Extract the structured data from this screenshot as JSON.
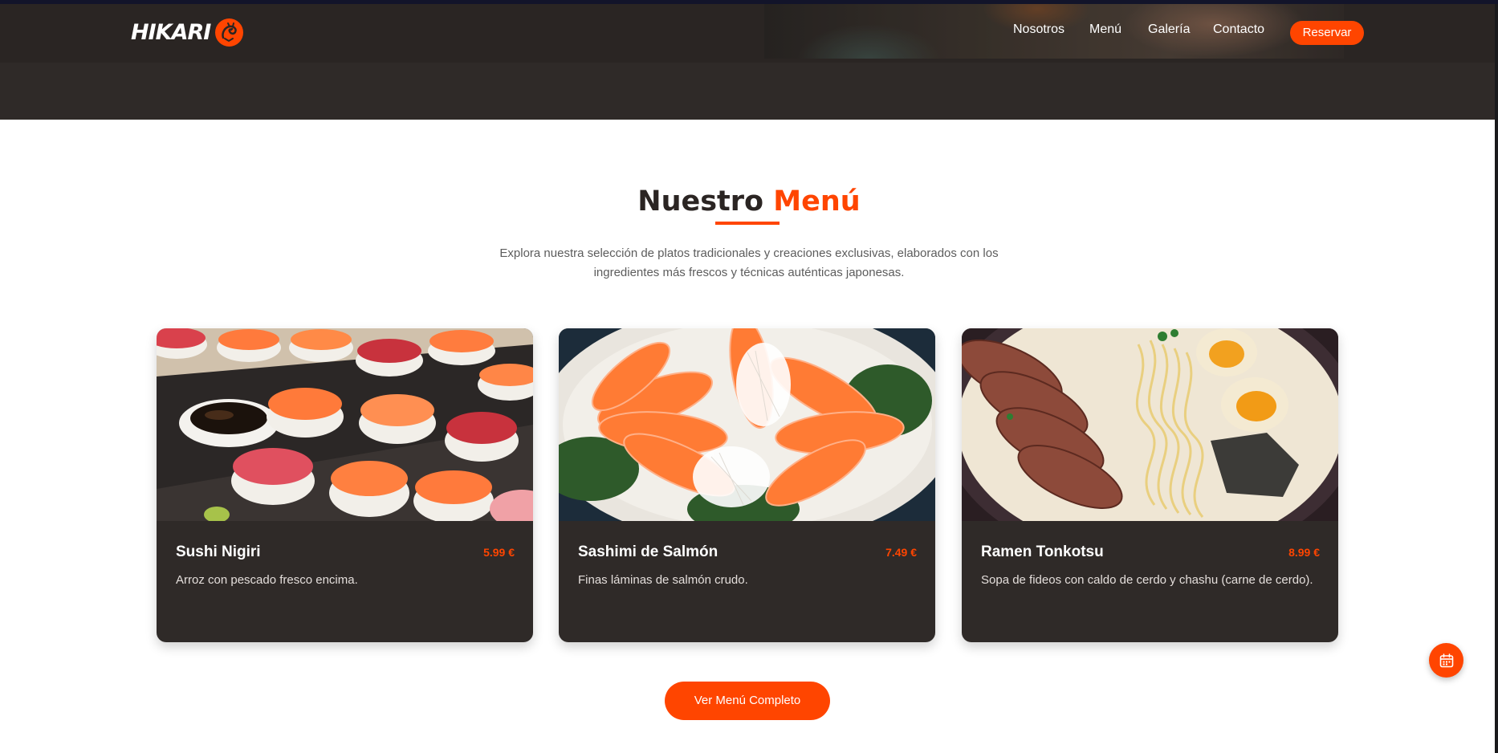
{
  "brand": {
    "name": "HIKARI",
    "logo_icon": "dragon-icon"
  },
  "nav": {
    "items": [
      {
        "label": "Nosotros"
      },
      {
        "label": "Menú"
      },
      {
        "label": "Galería"
      },
      {
        "label": "Contacto"
      }
    ],
    "reserve_label": "Reservar"
  },
  "menu_section": {
    "title_main": "Nuestro",
    "title_accent": "Menú",
    "intro_line1": "Explora nuestra selección de platos tradicionales y creaciones exclusivas, elaborados con los",
    "intro_line2": "ingredientes más frescos y técnicas auténticas japonesas.",
    "dishes": [
      {
        "name": "Sushi Nigiri",
        "price": "5.99 €",
        "description": "Arroz con pescado fresco encima."
      },
      {
        "name": "Sashimi de Salmón",
        "price": "7.49 €",
        "description": "Finas láminas de salmón crudo."
      },
      {
        "name": "Ramen Tonkotsu",
        "price": "8.99 €",
        "description": "Sopa de fideos con caldo de cerdo y chashu (carne de cerdo)."
      }
    ],
    "cta_label": "Ver Menú Completo"
  },
  "floating_button": {
    "icon": "calendar-icon"
  },
  "colors": {
    "accent": "#ff4500",
    "dark": "#2f2a28",
    "header": "#2a2523",
    "text_muted": "#5c5c5c"
  }
}
